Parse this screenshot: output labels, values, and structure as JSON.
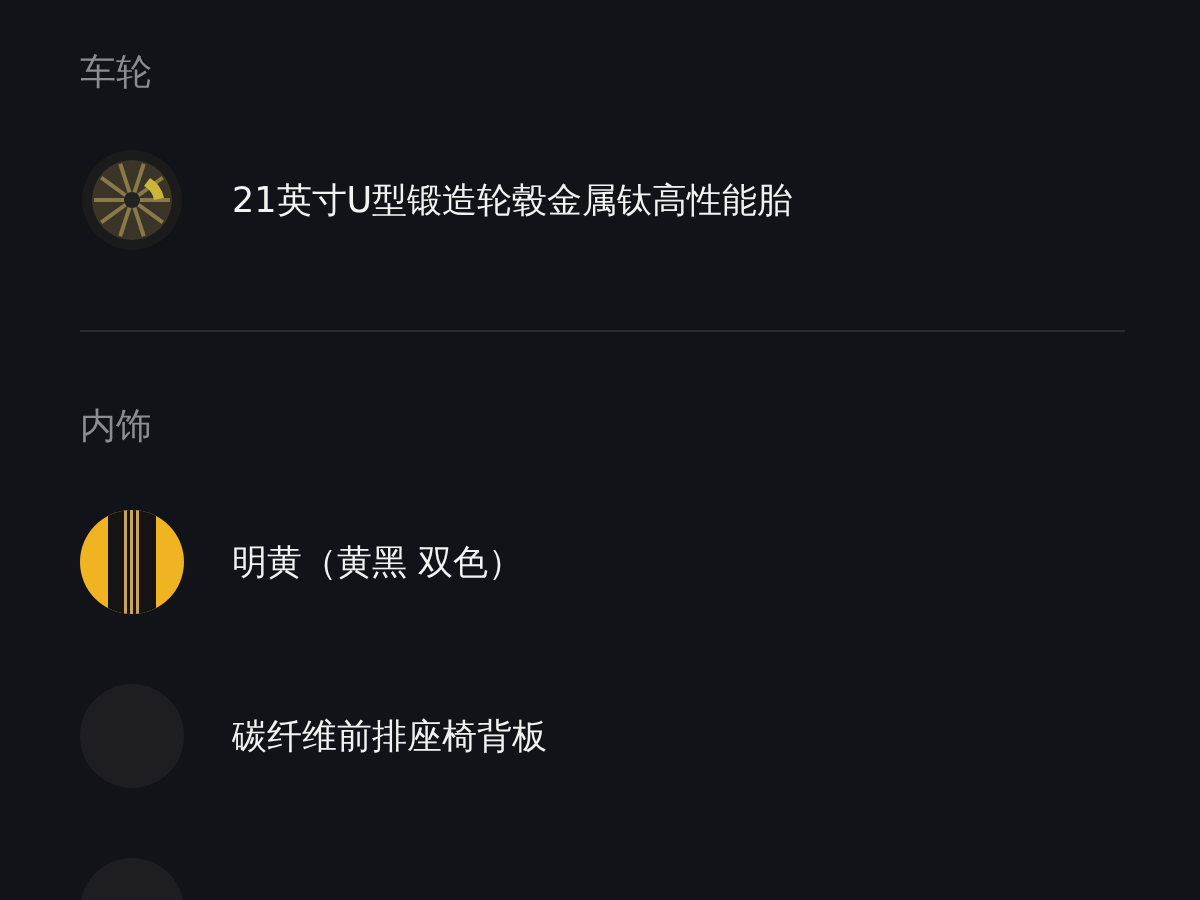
{
  "sections": [
    {
      "title": "车轮",
      "items": [
        {
          "kind": "wheel",
          "label": "21英寸U型锻造轮毂金属钛高性能胎"
        }
      ]
    },
    {
      "title": "内饰",
      "items": [
        {
          "kind": "swatch",
          "label": "明黄（黄黑 双色）"
        },
        {
          "kind": "photo",
          "label": "碳纤维前排座椅背板"
        },
        {
          "kind": "photo"
        }
      ]
    }
  ]
}
